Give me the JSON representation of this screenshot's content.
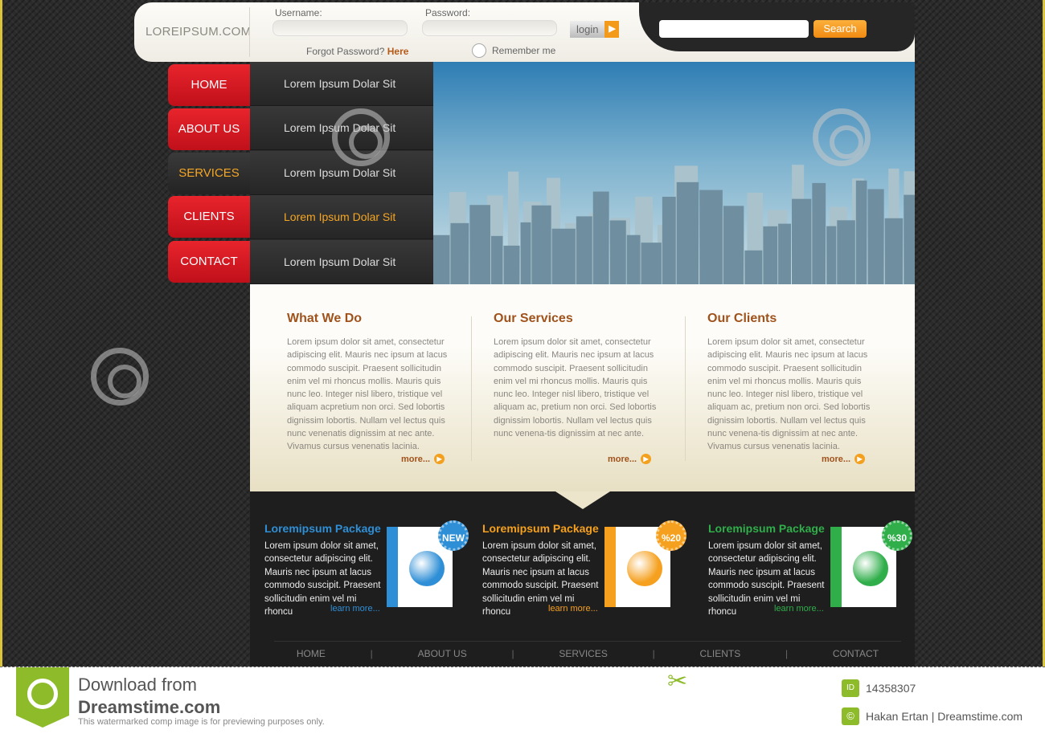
{
  "header": {
    "logo": "LOREIPSUM.COM",
    "username_label": "Username:",
    "password_label": "Password:",
    "login_label": "login",
    "forgot_text": "Forgot Password?",
    "forgot_link": "Here",
    "remember_label": "Remember me",
    "search_label": "Search"
  },
  "nav": {
    "tabs": [
      {
        "label": "HOME"
      },
      {
        "label": "ABOUT US"
      },
      {
        "label": "SERVICES",
        "active": true
      },
      {
        "label": "CLIENTS"
      },
      {
        "label": "CONTACT"
      }
    ],
    "submenu": [
      {
        "label": "Lorem Ipsum Dolar Sit"
      },
      {
        "label": "Lorem Ipsum Dolar Sit"
      },
      {
        "label": "Lorem Ipsum Dolar Sit"
      },
      {
        "label": "Lorem Ipsum Dolar Sit",
        "active": true
      },
      {
        "label": "Lorem Ipsum Dolar Sit"
      }
    ]
  },
  "content": {
    "columns": [
      {
        "title": "What We Do",
        "text": "Lorem ipsum dolor sit amet, consectetur adipiscing elit. Mauris nec ipsum at lacus commodo suscipit. Praesent sollicitudin enim vel mi rhoncus mollis. Mauris quis nunc leo. Integer nisl libero, tristique vel aliquam acpretium non orci. Sed lobortis dignissim lobortis. Nullam vel lectus quis nunc venenatis dignissim at nec ante. Vivamus cursus venenatis lacinia.",
        "more": "more..."
      },
      {
        "title": "Our Services",
        "text": "Lorem ipsum dolor sit amet, consectetur adipiscing elit. Mauris nec ipsum at lacus commodo suscipit. Praesent sollicitudin enim vel mi rhoncus mollis. Mauris quis nunc leo. Integer nisl libero, tristique vel aliquam ac, pretium non orci. Sed lobortis dignissim lobortis. Nullam vel lectus quis nunc venena-tis dignissim at nec ante.",
        "more": "more..."
      },
      {
        "title": "Our Clients",
        "text": "Lorem ipsum dolor sit amet, consectetur adipiscing elit. Mauris nec ipsum at lacus commodo suscipit. Praesent sollicitudin enim vel mi rhoncus mollis. Mauris quis nunc leo. Integer nisl libero, tristique vel aliquam ac, pretium non orci. Sed lobortis dignissim lobortis. Nullam vel lectus quis nunc venena-tis dignissim at nec ante. Vivamus cursus venenatis lacinia.",
        "more": "more..."
      }
    ]
  },
  "packages": [
    {
      "title": "Loremipsum Package",
      "text": "Lorem ipsum dolor sit amet, consectetur adipiscing elit. Mauris nec ipsum at lacus commodo suscipit. Praesent sollicitudin enim vel mi rhoncu",
      "link": "learn more...",
      "badge": "NEW",
      "color": "#2f8fd6"
    },
    {
      "title": "Loremipsum Package",
      "text": "Lorem ipsum dolor sit amet, consectetur adipiscing elit. Mauris nec ipsum at lacus commodo suscipit. Praesent sollicitudin enim vel mi rhoncu",
      "link": "learn more...",
      "badge": "%20",
      "color": "#f5a01e"
    },
    {
      "title": "Loremipsum Package",
      "text": "Lorem ipsum dolor sit amet, consectetur adipiscing elit. Mauris nec ipsum at lacus commodo suscipit. Praesent sollicitudin enim vel mi rhoncu",
      "link": "learn more...",
      "badge": "%30",
      "color": "#2fae4a"
    }
  ],
  "footer_nav": [
    "HOME",
    "ABOUT US",
    "SERVICES",
    "CLIENTS",
    "CONTACT"
  ],
  "watermark": {
    "download": "Download from",
    "site": "Dreamstime.com",
    "note": "This watermarked comp image is for previewing purposes only.",
    "id": "14358307",
    "credit": "Hakan Ertan | Dreamstime.com",
    "id_label": "ID",
    "brand": "dreamstime"
  }
}
